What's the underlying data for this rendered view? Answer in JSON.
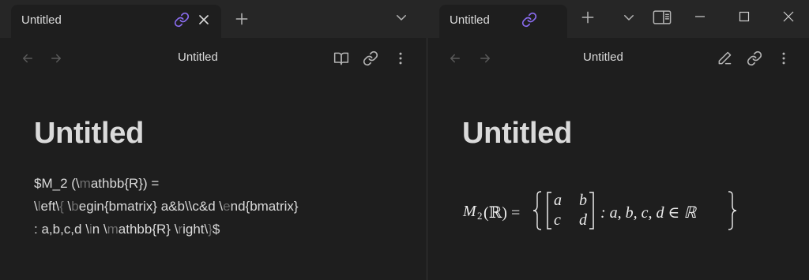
{
  "tabs": [
    {
      "title": "Untitled"
    },
    {
      "title": "Untitled"
    }
  ],
  "left_pane": {
    "view_title": "Untitled",
    "note_title": "Untitled",
    "source_lines": [
      "$M_2 (\\mathbb{R}) =",
      "\\left\\{ \\begin{bmatrix} a&b\\\\c&d \\end{bmatrix}",
      ": a,b,c,d \\in \\mathbb{R} \\right\\}$"
    ]
  },
  "right_pane": {
    "view_title": "Untitled",
    "note_title": "Untitled",
    "math": {
      "lhs": "M",
      "sub": "2",
      "paren": "(ℝ) =",
      "matrix": [
        [
          "a",
          "b"
        ],
        [
          "c",
          "d"
        ]
      ],
      "rhs": ": a, b, c, d ∈ ℝ"
    }
  },
  "icons": {
    "link_tab": "link-icon",
    "close_tab": "close-icon",
    "new_tab": "plus-icon",
    "tab_list": "chevron-down-icon",
    "sidebar": "sidebar-toggle-icon",
    "minimize": "minimize-icon",
    "maximize": "maximize-icon",
    "close_window": "close-window-icon",
    "back": "arrow-left-icon",
    "forward": "arrow-right-icon",
    "reading_view": "book-open-icon",
    "edit_view": "pencil-icon",
    "more": "more-vertical-icon"
  },
  "colors": {
    "accent": "#8a6cf0",
    "background": "#1e1e1e",
    "tabbar": "#262626",
    "text": "#dadada",
    "dim_syntax": "#6e6e6e"
  }
}
